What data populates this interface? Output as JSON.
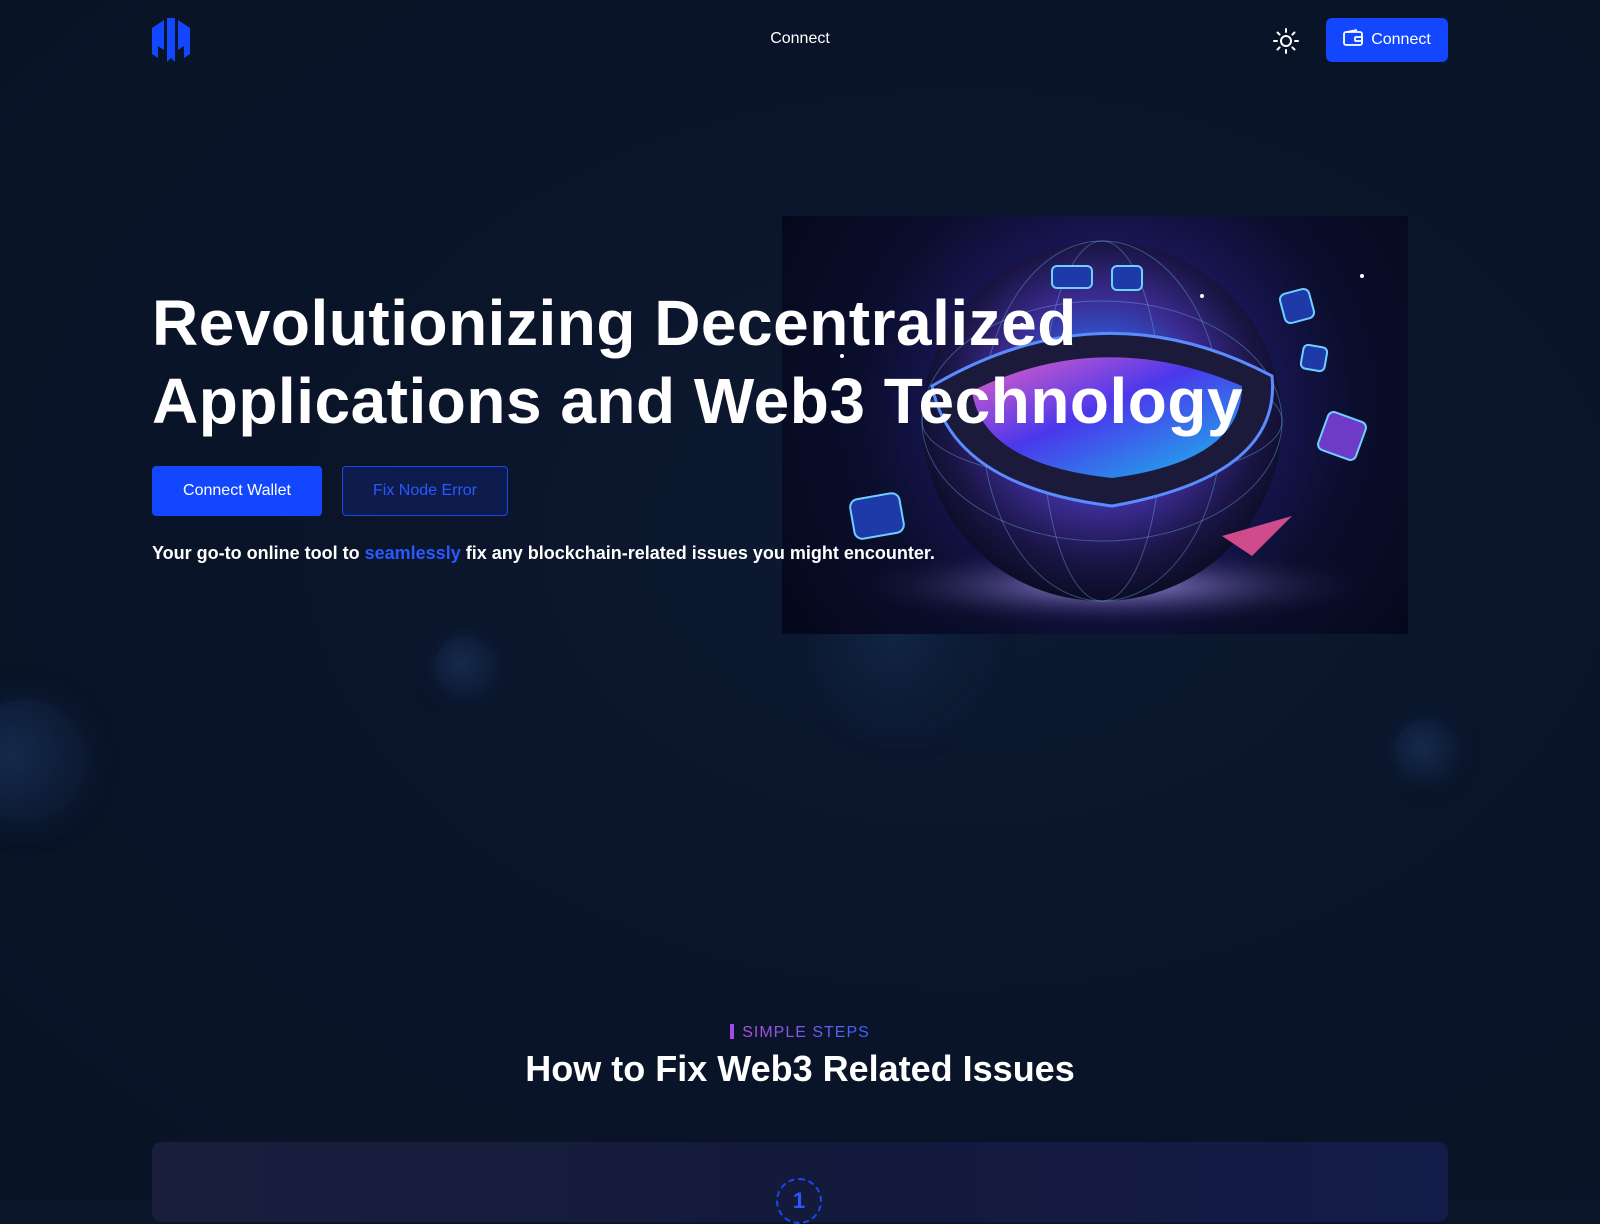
{
  "header": {
    "logo_icon": "hexagon-logo-icon",
    "nav_link": "Connect",
    "theme_icon": "sun-icon",
    "connect_button": "Connect",
    "wallet_icon": "wallet-icon"
  },
  "hero": {
    "title_line1": "Revolutionizing Decentralized",
    "title_line2": "Applications and Web3 Technology",
    "connect_wallet_button": "Connect Wallet",
    "fix_node_button": "Fix Node Error",
    "tagline_before": "Your go-to online tool to ",
    "tagline_accent": "seamlessly",
    "tagline_after": " fix any blockchain-related issues you might encounter."
  },
  "steps": {
    "eyebrow": "SIMPLE STEPS",
    "title": "How to Fix Web3 Related Issues",
    "first_step_number": "1"
  },
  "colors": {
    "background": "#0b1529",
    "accent": "#1246ff",
    "accent_text": "#2a58ff",
    "eyebrow_gradient_start": "#b24fd9"
  }
}
